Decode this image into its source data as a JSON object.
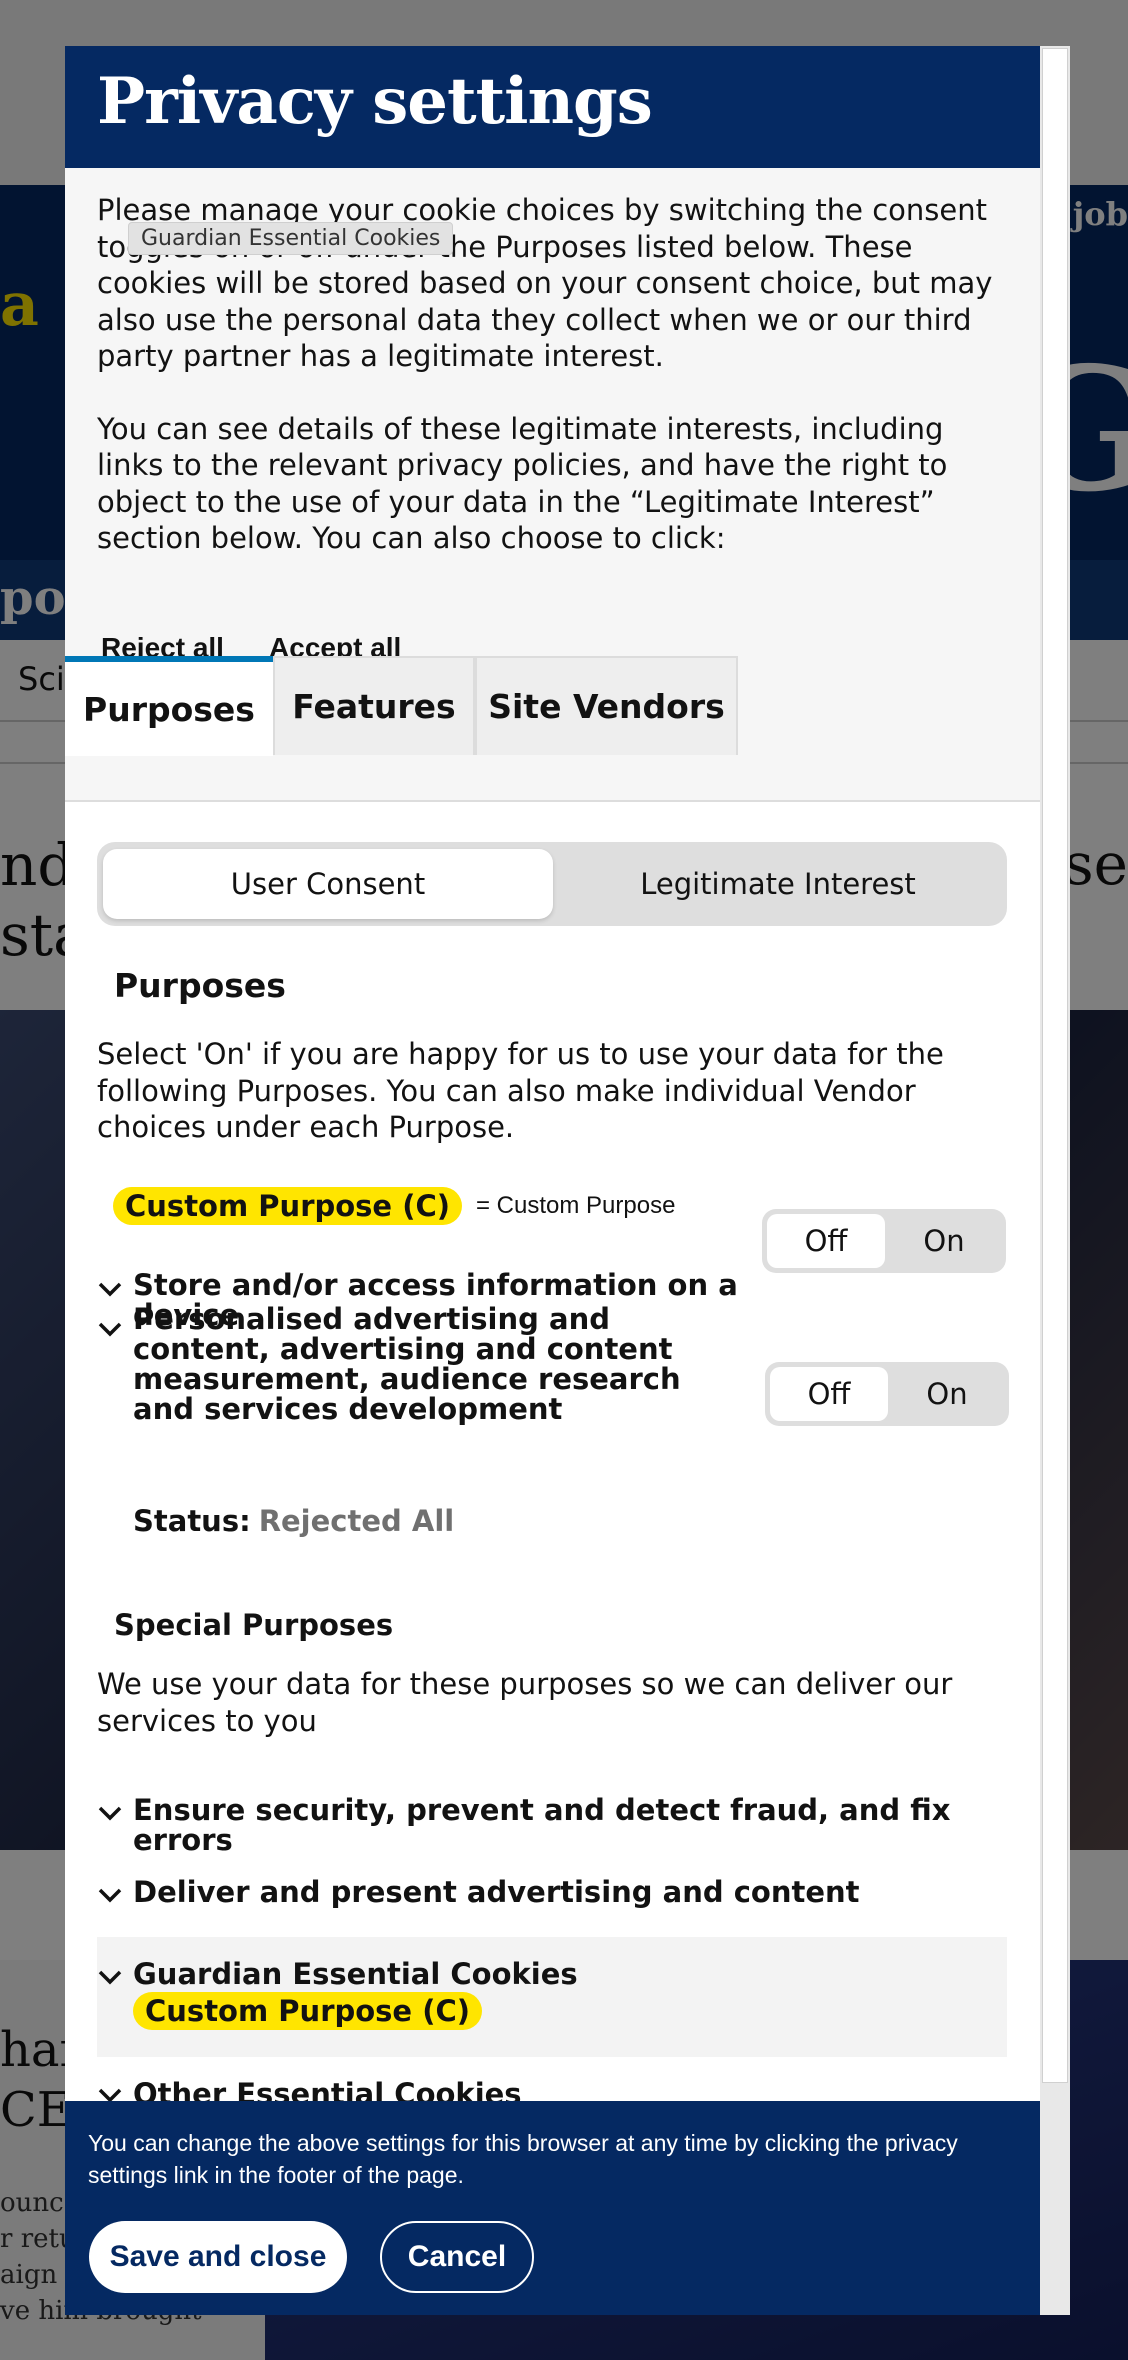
{
  "background": {
    "nav_right": "n job",
    "nav_left": "port",
    "science_tab": "Scie",
    "headline_left": "nd I",
    "headline_left2": "sta",
    "headline_right": "ase",
    "lower_headline": "han",
    "lower_headline2": "CE(",
    "lower_text": "ounc",
    "lower_text2": "r retu",
    "lower_text3": "aign",
    "lower_text4": "ve him brought",
    "big_letter": "G",
    "yellow_text": "a"
  },
  "modal": {
    "title": "Privacy settings",
    "intro_p1": "Please manage your cookie choices by switching the consent toggles on or off under the Purposes listed below. These cookies will be stored based on your consent choice, but may also use the personal data they collect when we or our third party partner has a legitimate interest.",
    "intro_p2": "You can see details of these legitimate interests, including links to the relevant privacy policies, and have the right to object to the use of your data in the “Legitimate Interest” section below. You can also choose to click:",
    "tooltip": "Guardian Essential Cookies",
    "reject_all": "Reject all",
    "accept_all": "Accept all",
    "tabs": [
      "Purposes",
      "Features",
      "Site Vendors"
    ],
    "segments": {
      "user_consent": "User Consent",
      "legitimate_interest": "Legitimate Interest"
    },
    "purposes_heading": "Purposes",
    "purposes_desc": "Select 'On' if you are happy for us to use your data for the following Purposes. You can also make individual Vendor choices under each Purpose.",
    "custom_purpose_badge": "Custom Purpose (C)",
    "custom_purpose_legend": "= Custom Purpose",
    "rows": [
      {
        "title": "Store and/or access information on a device",
        "off": "Off",
        "on": "On",
        "state": "off"
      },
      {
        "title": "Personalised advertising and content, advertising and content measurement, audience research and services development",
        "off": "Off",
        "on": "On",
        "state": "off"
      }
    ],
    "status_label": "Status:",
    "status_value": "Rejected All",
    "special_heading": "Special Purposes",
    "special_desc": "We use your data for these purposes so we can deliver our services to you",
    "special_rows": [
      "Ensure security, prevent and detect fraud, and fix errors",
      "Deliver and present advertising and content",
      "Guardian Essential Cookies",
      "Other Essential Cookies"
    ],
    "footer_text": "You can change the above settings for this browser at any time by clicking the privacy settings link in the footer of the page.",
    "save_label": "Save and close",
    "cancel_label": "Cancel"
  },
  "colors": {
    "brand_navy": "#052962",
    "badge_yellow": "#ffe500",
    "tab_accent": "#0077b6"
  },
  "icons": {
    "expand": "chevron-down-icon"
  }
}
